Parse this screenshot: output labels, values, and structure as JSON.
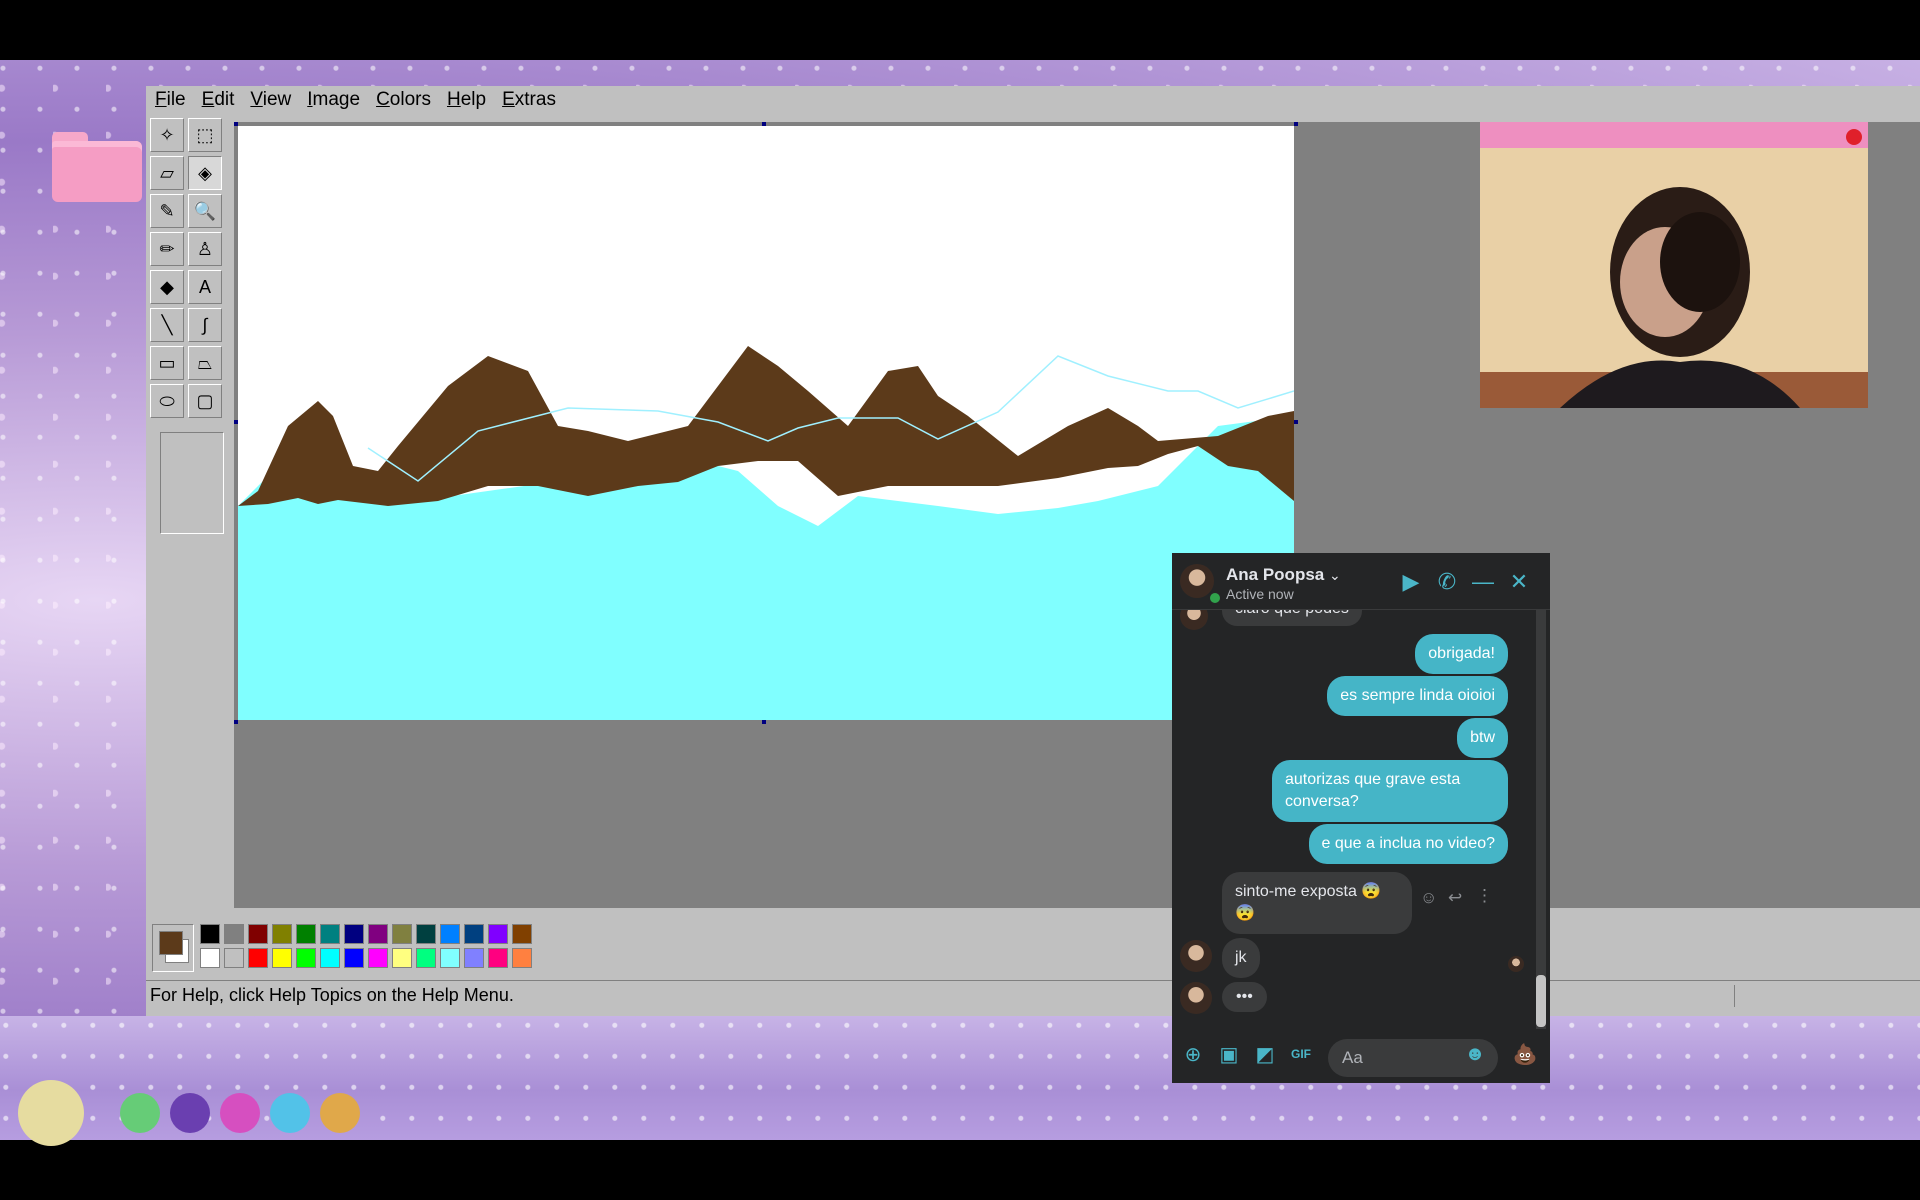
{
  "paint": {
    "menu": [
      "File",
      "Edit",
      "View",
      "Image",
      "Colors",
      "Help",
      "Extras"
    ],
    "status": "For Help, click Help Topics on the Help Menu.",
    "tools": [
      {
        "name": "free-form-select-icon",
        "glyph": "✧"
      },
      {
        "name": "select-icon",
        "glyph": "⬚"
      },
      {
        "name": "eraser-icon",
        "glyph": "▱"
      },
      {
        "name": "fill-bucket-icon",
        "glyph": "◈"
      },
      {
        "name": "color-picker-icon",
        "glyph": "✎"
      },
      {
        "name": "magnifier-icon",
        "glyph": "🔍"
      },
      {
        "name": "pencil-icon",
        "glyph": "✏"
      },
      {
        "name": "brush-icon",
        "glyph": "♙"
      },
      {
        "name": "airbrush-icon",
        "glyph": "◆"
      },
      {
        "name": "text-icon",
        "glyph": "A"
      },
      {
        "name": "line-icon",
        "glyph": "╲"
      },
      {
        "name": "curve-icon",
        "glyph": "∫"
      },
      {
        "name": "rectangle-icon",
        "glyph": "▭"
      },
      {
        "name": "polygon-icon",
        "glyph": "⏢"
      },
      {
        "name": "ellipse-icon",
        "glyph": "⬭"
      },
      {
        "name": "rounded-rectangle-icon",
        "glyph": "▢"
      }
    ],
    "palette_top": [
      "#000000",
      "#808080",
      "#800000",
      "#808000",
      "#008000",
      "#008080",
      "#000080",
      "#800080",
      "#808040",
      "#004040",
      "#0080ff",
      "#004080",
      "#8000ff",
      "#804000"
    ],
    "palette_bottom": [
      "#ffffff",
      "#c0c0c0",
      "#ff0000",
      "#ffff00",
      "#00ff00",
      "#00ffff",
      "#0000ff",
      "#ff00ff",
      "#ffff80",
      "#00ff80",
      "#80ffff",
      "#8080ff",
      "#ff0080",
      "#ff8040"
    ],
    "foreground": "#5c3a1a",
    "background_color": "#ffffff",
    "canvas_colors": {
      "sky": "#ffffff",
      "water": "#80ffff",
      "mountain": "#5c3a1a"
    }
  },
  "chat": {
    "name": "Ana Poopsa",
    "status": "Active now",
    "partial_message": "claro que podes",
    "messages": [
      {
        "dir": "out",
        "text": "obrigada!"
      },
      {
        "dir": "out",
        "text": "es sempre linda oioioi"
      },
      {
        "dir": "out",
        "text": "btw"
      },
      {
        "dir": "out",
        "text": "autorizas que grave esta conversa?"
      },
      {
        "dir": "out",
        "text": "e que a inclua no video?"
      },
      {
        "dir": "in",
        "text": "sinto-me exposta 😨😨"
      },
      {
        "dir": "in",
        "text": "jk"
      },
      {
        "dir": "in",
        "text": "•••"
      }
    ],
    "input_placeholder": "Aa",
    "accent": "#45b5c7"
  },
  "dock_colors": [
    "#e6dca0",
    "#66cc77",
    "#6a3fb0",
    "#d64fc0",
    "#52c2e8",
    "#e0a84a"
  ]
}
